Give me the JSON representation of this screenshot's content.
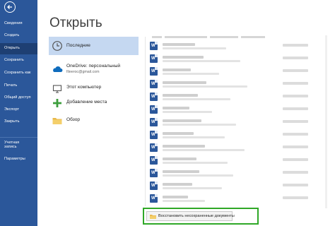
{
  "nav": {
    "items": [
      {
        "label": "Сведения"
      },
      {
        "label": "Создать"
      },
      {
        "label": "Открыть"
      },
      {
        "label": "Сохранить"
      },
      {
        "label": "Сохранить как"
      },
      {
        "label": "Печать"
      },
      {
        "label": "Общий доступ"
      },
      {
        "label": "Экспорт"
      },
      {
        "label": "Закрыть"
      },
      {
        "label": "Учетная"
      },
      {
        "label": "запись"
      },
      {
        "label": "Параметры"
      }
    ]
  },
  "page": {
    "title": "Открыть"
  },
  "locations": [
    {
      "label": "Последние",
      "icon": "clock-icon"
    },
    {
      "label": "OneDrive: персональный",
      "sub": "fileeroc@gmail.com",
      "icon": "onedrive-cloud-icon"
    },
    {
      "label": "Этот компьютер",
      "icon": "computer-icon"
    },
    {
      "label": "Добавление места",
      "icon": "plus-icon"
    },
    {
      "label": "Обзор",
      "icon": "folder-icon"
    }
  ],
  "files": {
    "icon_letter": "W"
  },
  "recover": {
    "label": "Восстановить несохраненные документы"
  },
  "colors": {
    "nav_bg": "#2b579a",
    "selected": "#c5d8f1",
    "highlight": "#2fa827"
  }
}
